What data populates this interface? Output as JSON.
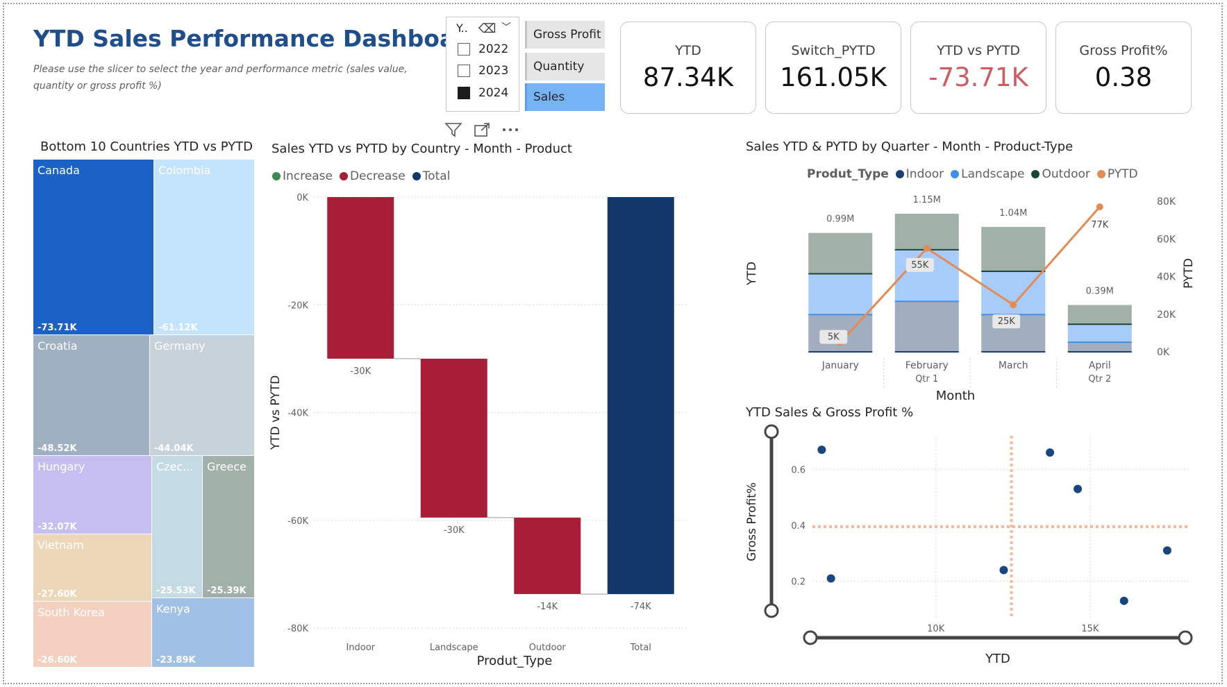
{
  "header": {
    "title": "YTD Sales Performance Dashboard",
    "subtitle": "Please use the slicer to select the year and performance metric (sales value, quantity or gross profit %)"
  },
  "slicer": {
    "header": "Y..",
    "years": [
      {
        "label": "2022",
        "checked": false
      },
      {
        "label": "2023",
        "checked": false
      },
      {
        "label": "2024",
        "checked": true
      }
    ]
  },
  "metric_buttons": [
    {
      "label": "Gross Profit",
      "selected": false
    },
    {
      "label": "Quantity",
      "selected": false
    },
    {
      "label": "Sales",
      "selected": true
    }
  ],
  "toolbar": [
    "filter-icon",
    "focus-mode-icon",
    "more-options-icon"
  ],
  "cards": [
    {
      "label": "YTD",
      "value": "87.34K",
      "negative": false
    },
    {
      "label": "Switch_PYTD",
      "value": "161.05K",
      "negative": false
    },
    {
      "label": "YTD vs PYTD",
      "value": "-73.71K",
      "negative": true
    },
    {
      "label": "Gross Profit%",
      "value": "0.38",
      "negative": false
    }
  ],
  "treemap": {
    "title": "Bottom 10 Countries YTD vs PYTD",
    "items": [
      {
        "name": "Canada",
        "value": "-73.71K",
        "color": "#1a62c5"
      },
      {
        "name": "Colombia",
        "value": "-61.12K",
        "color": "#c4e3fc"
      },
      {
        "name": "Croatia",
        "value": "-48.52K",
        "color": "#9fb0c2"
      },
      {
        "name": "Germany",
        "value": "-44.04K",
        "color": "#c6d1da"
      },
      {
        "name": "Hungary",
        "value": "-32.07K",
        "color": "#c6bdf0"
      },
      {
        "name": "Vietnam",
        "value": "-27.60K",
        "color": "#ecd7b8"
      },
      {
        "name": "South Korea",
        "value": "-26.60K",
        "color": "#f3d0bf"
      },
      {
        "name": "Czec...",
        "value": "-25.53K",
        "color": "#c4dbe6"
      },
      {
        "name": "Greece",
        "value": "-25.39K",
        "color": "#a2b0aa"
      },
      {
        "name": "Kenya",
        "value": "-23.89K",
        "color": "#a1c0e6"
      }
    ]
  },
  "waterfall": {
    "title": "Sales YTD vs PYTD by Country - Month - Product",
    "legend": [
      {
        "label": "Increase",
        "color": "#3a8a55"
      },
      {
        "label": "Decrease",
        "color": "#a91e37"
      },
      {
        "label": "Total",
        "color": "#12386b"
      }
    ],
    "chart_data": {
      "type": "bar",
      "subtype": "waterfall",
      "xlabel": "Produt_Type",
      "ylabel": "YTD vs PYTD",
      "ylim": [
        -80000,
        0
      ],
      "yticks": [
        "0K",
        "-20K",
        "-40K",
        "-60K",
        "-80K"
      ],
      "categories": [
        "Indoor",
        "Landscape",
        "Outdoor",
        "Total"
      ],
      "values": [
        -30000,
        -29500,
        -14200,
        -73710
      ],
      "labels": [
        "-30K",
        "-30K",
        "-14K",
        "-74K"
      ],
      "kinds": [
        "decrease",
        "decrease",
        "decrease",
        "total"
      ],
      "grid": true
    }
  },
  "combo": {
    "title": "Sales YTD & PYTD by Quarter - Month - Product-Type",
    "legend_title": "Produt_Type",
    "legend": [
      {
        "label": "Indoor",
        "color": "#1a3f70"
      },
      {
        "label": "Landscape",
        "color": "#3d8fe8"
      },
      {
        "label": "Outdoor",
        "color": "#1c4634"
      },
      {
        "label": "PYTD",
        "color": "#e38a55"
      }
    ],
    "chart_data": {
      "type": "bar",
      "subtype": "stacked-column-with-line",
      "xlabel": "Month",
      "ylabel": "YTD",
      "y2label": "PYTD",
      "y2lim": [
        0,
        80000
      ],
      "y2ticks": [
        "0K",
        "20K",
        "40K",
        "60K",
        "80K"
      ],
      "categories": [
        "January",
        "February",
        "March",
        "April"
      ],
      "quarters": [
        "Qtr 1",
        "Qtr 1",
        "Qtr 1",
        "Qtr 2"
      ],
      "quarter_labels": [
        {
          "label": "Qtr 1",
          "under": 1
        },
        {
          "label": "Qtr 2",
          "under": 3
        }
      ],
      "series": [
        {
          "name": "Indoor",
          "values": [
            0.31,
            0.42,
            0.31,
            0.08
          ]
        },
        {
          "name": "Landscape",
          "values": [
            0.34,
            0.43,
            0.36,
            0.15
          ]
        },
        {
          "name": "Outdoor",
          "values": [
            0.34,
            0.3,
            0.37,
            0.16
          ]
        }
      ],
      "totals": [
        0.99,
        1.15,
        1.04,
        0.39
      ],
      "total_labels": [
        "0.99M",
        "1.15M",
        "1.04M",
        "0.39M"
      ],
      "line": {
        "name": "PYTD",
        "values": [
          5000,
          55000,
          25000,
          77000
        ],
        "labels": [
          "5K",
          "55K",
          "25K",
          "77K"
        ]
      },
      "ylim": [
        0,
        1.3
      ]
    }
  },
  "scatter": {
    "title": "YTD Sales & Gross Profit %",
    "chart_data": {
      "type": "scatter",
      "xlabel": "YTD",
      "ylabel": "Gross Profit%",
      "xlim": [
        6000,
        18200
      ],
      "ylim": [
        0.07,
        0.72
      ],
      "xticks": [
        {
          "v": 10000,
          "label": "10K"
        },
        {
          "v": 15000,
          "label": "15K"
        }
      ],
      "yticks": [
        {
          "v": 0.2,
          "label": "0.2"
        },
        {
          "v": 0.4,
          "label": "0.4"
        },
        {
          "v": 0.6,
          "label": "0.6"
        }
      ],
      "x_avg": 12450,
      "y_avg": 0.395,
      "points": [
        {
          "x": 6300,
          "y": 0.67
        },
        {
          "x": 6600,
          "y": 0.21
        },
        {
          "x": 12200,
          "y": 0.24
        },
        {
          "x": 13700,
          "y": 0.66
        },
        {
          "x": 14600,
          "y": 0.53
        },
        {
          "x": 16100,
          "y": 0.13
        },
        {
          "x": 17500,
          "y": 0.31
        }
      ],
      "grid": true
    }
  }
}
